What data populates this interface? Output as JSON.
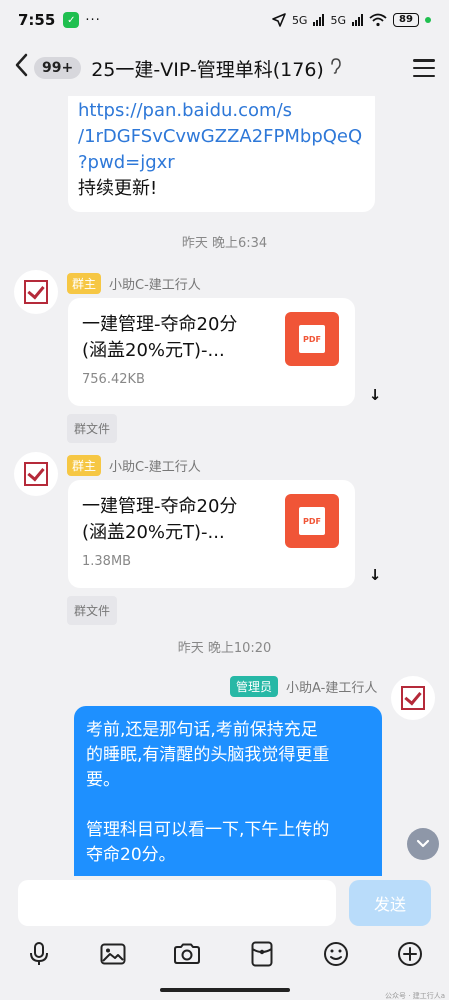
{
  "status_bar": {
    "time": "7:55",
    "app_badge": "✓",
    "more": "···",
    "network1": "5G",
    "network2": "5G",
    "battery": "89"
  },
  "header": {
    "back": "‹",
    "unread": "99+",
    "title": "25一建-VIP-管理单科(176)",
    "ear": "ʖ"
  },
  "messages": {
    "link_message": {
      "url_lines": [
        "https://pan.baidu.com/s",
        "/1rDGFSvCvwGZZA2FPMbpQeQ",
        "?pwd=jgxr"
      ],
      "tail": "持续更新!"
    },
    "time1": "昨天 晚上6:34",
    "file1": {
      "tag": "群主",
      "sender": "小助C-建工行人",
      "name_line1": "一建管理-夺命20分",
      "name_line2": "(涵盖20%元T)-...",
      "size": "756.42KB",
      "icon_label": "PDF",
      "group_tag": "群文件"
    },
    "file2": {
      "tag": "群主",
      "sender": "小助C-建工行人",
      "name_line1": "一建管理-夺命20分",
      "name_line2": "(涵盖20%元T)-...",
      "size": "1.38MB",
      "icon_label": "PDF",
      "group_tag": "群文件"
    },
    "time2": "昨天 晚上10:20",
    "admin_message": {
      "tag": "管理员",
      "sender": "小助A-建工行人",
      "lines": [
        "考前,还是那句话,考前保持充足",
        "的睡眠,有清醒的头脑我觉得更重",
        "要。",
        "",
        "管理科目可以看一下,下午上传的",
        "夺命20分。"
      ]
    }
  },
  "input": {
    "placeholder": "",
    "send_label": "发送"
  },
  "toolbar": {
    "icons": [
      "microphone-icon",
      "image-icon",
      "camera-icon",
      "red-packet-icon",
      "emoji-icon",
      "plus-icon"
    ]
  },
  "watermark": "公众号 · 建工行人a"
}
